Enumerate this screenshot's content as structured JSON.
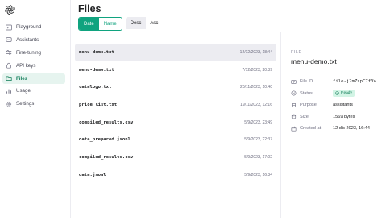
{
  "sidebar": {
    "items": [
      {
        "label": "Playground",
        "icon": "terminal-icon"
      },
      {
        "label": "Assistants",
        "icon": "assistant-icon"
      },
      {
        "label": "Fine-tuning",
        "icon": "sliders-icon"
      },
      {
        "label": "API keys",
        "icon": "lock-icon"
      },
      {
        "label": "Files",
        "icon": "files-icon",
        "active": true
      },
      {
        "label": "Usage",
        "icon": "chart-icon"
      },
      {
        "label": "Settings",
        "icon": "gear-icon"
      }
    ]
  },
  "header": {
    "title": "Files",
    "sort": {
      "date": "Date",
      "name": "Name",
      "desc": "Desc",
      "asc": "Asc"
    }
  },
  "files": [
    {
      "name": "menu-demo.txt",
      "date": "12/12/2023, 18:44",
      "selected": true
    },
    {
      "name": "menu-demo.txt",
      "date": "7/12/2023, 20:39"
    },
    {
      "name": "catalogo.txt",
      "date": "20/11/2023, 10:40"
    },
    {
      "name": "price_list.txt",
      "date": "19/11/2023, 12:16"
    },
    {
      "name": "compiled_results.csv",
      "date": "5/9/2023, 23:49"
    },
    {
      "name": "data_prepared.jsonl",
      "date": "5/9/2023, 22:37"
    },
    {
      "name": "compiled_results.csv",
      "date": "5/9/2023, 17:02"
    },
    {
      "name": "data.jsonl",
      "date": "5/9/2023, 16:34"
    }
  ],
  "detail": {
    "section_label": "FILE",
    "file_name": "menu-demo.txt",
    "fields": {
      "file_id": {
        "label": "File ID",
        "value": "file-j2mZspC7fVv"
      },
      "status": {
        "label": "Status",
        "value": "Ready"
      },
      "purpose": {
        "label": "Purpose",
        "value": "assistants"
      },
      "size": {
        "label": "Size",
        "value": "1569 bytes"
      },
      "created": {
        "label": "Created at",
        "value": "12 dic 2023, 16:44"
      }
    }
  },
  "colors": {
    "accent": "#10a37f",
    "accent_dark": "#0b7a55",
    "active_bg": "#e6f4ef",
    "selected_row": "#ececf1",
    "badge_bg": "#d2f4e5"
  }
}
